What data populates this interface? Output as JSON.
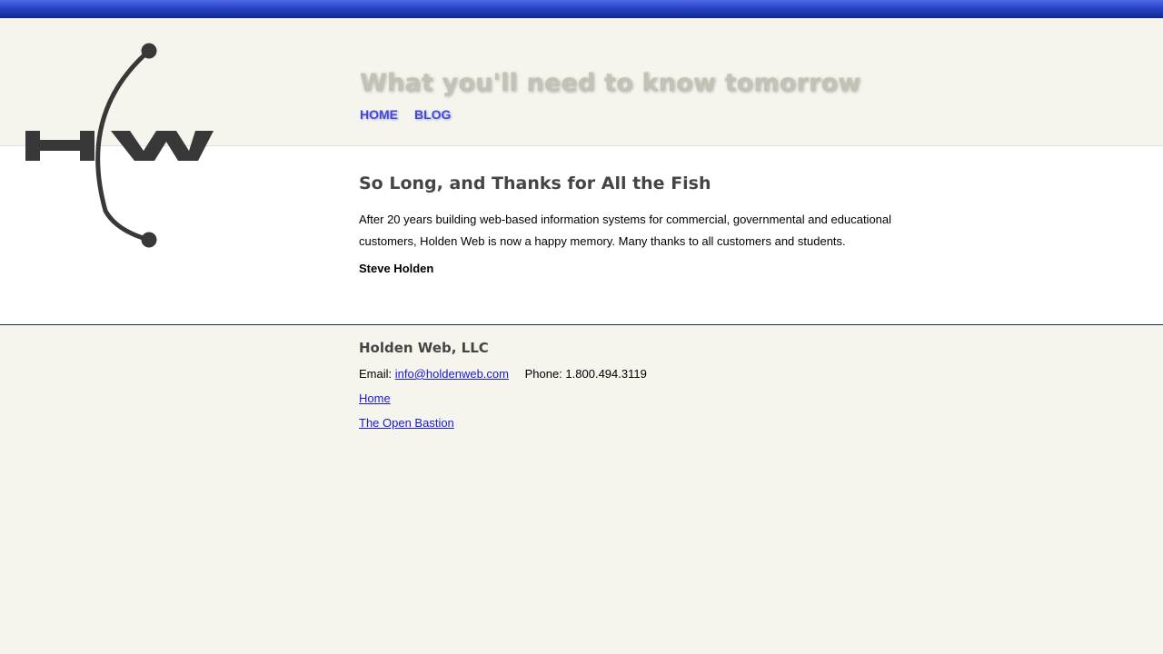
{
  "header": {
    "tagline": "What you'll need to know tomorrow",
    "nav": [
      {
        "label": "HOME"
      },
      {
        "label": "BLOG"
      }
    ]
  },
  "logo": {
    "icon": "hw-logo-icon"
  },
  "post": {
    "title": "So Long, and Thanks for All the Fish",
    "body": "After 20 years building web-based information systems for commercial, governmental and educational customers, Holden Web is now a happy memory. Many thanks to all customers and students.",
    "author": "Steve Holden"
  },
  "footer": {
    "company": "Holden Web, LLC",
    "email_label": "Email:",
    "email": "info@holdenweb.com",
    "phone_label": "Phone:",
    "phone": "1.800.494.3119",
    "links": [
      {
        "label": "Home"
      },
      {
        "label": "The Open Bastion"
      }
    ]
  },
  "colors": {
    "top_bar": "#2a44c8",
    "background": "#f5f4ed",
    "nav_link": "#4248e0",
    "heading": "#454545",
    "link": "#1a1ad4"
  }
}
